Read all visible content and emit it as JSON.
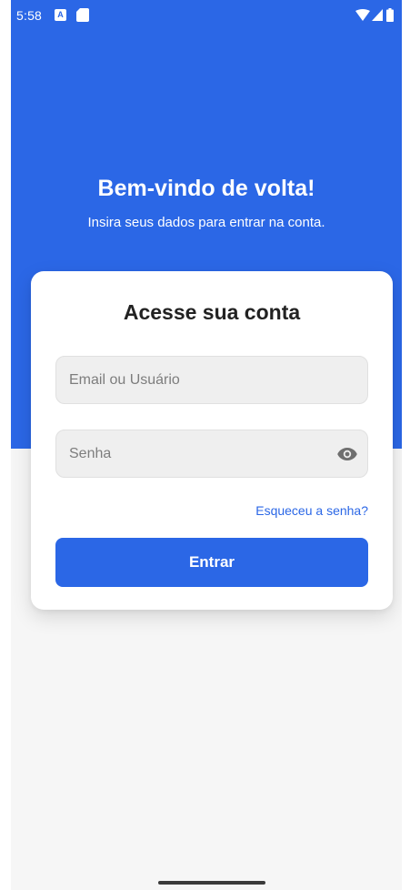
{
  "status_bar": {
    "time": "5:58",
    "notification_icons": [
      "a-icon",
      "sd-card-icon"
    ],
    "system_icons": [
      "wifi-icon",
      "signal-icon",
      "battery-icon"
    ]
  },
  "hero": {
    "title": "Bem-vindo de volta!",
    "subtitle": "Insira seus dados para entrar na conta."
  },
  "login_card": {
    "title": "Acesse sua conta",
    "email_placeholder": "Email ou Usuário",
    "email_value": "",
    "password_placeholder": "Senha",
    "password_value": "",
    "toggle_visibility_icon": "eye-icon",
    "forgot_password_label": "Esqueceu a senha?",
    "submit_label": "Entrar"
  },
  "colors": {
    "primary": "#2b67e6",
    "background": "#f6f6f6",
    "card": "#ffffff",
    "field_background": "#efefef",
    "title_text": "#222222"
  }
}
